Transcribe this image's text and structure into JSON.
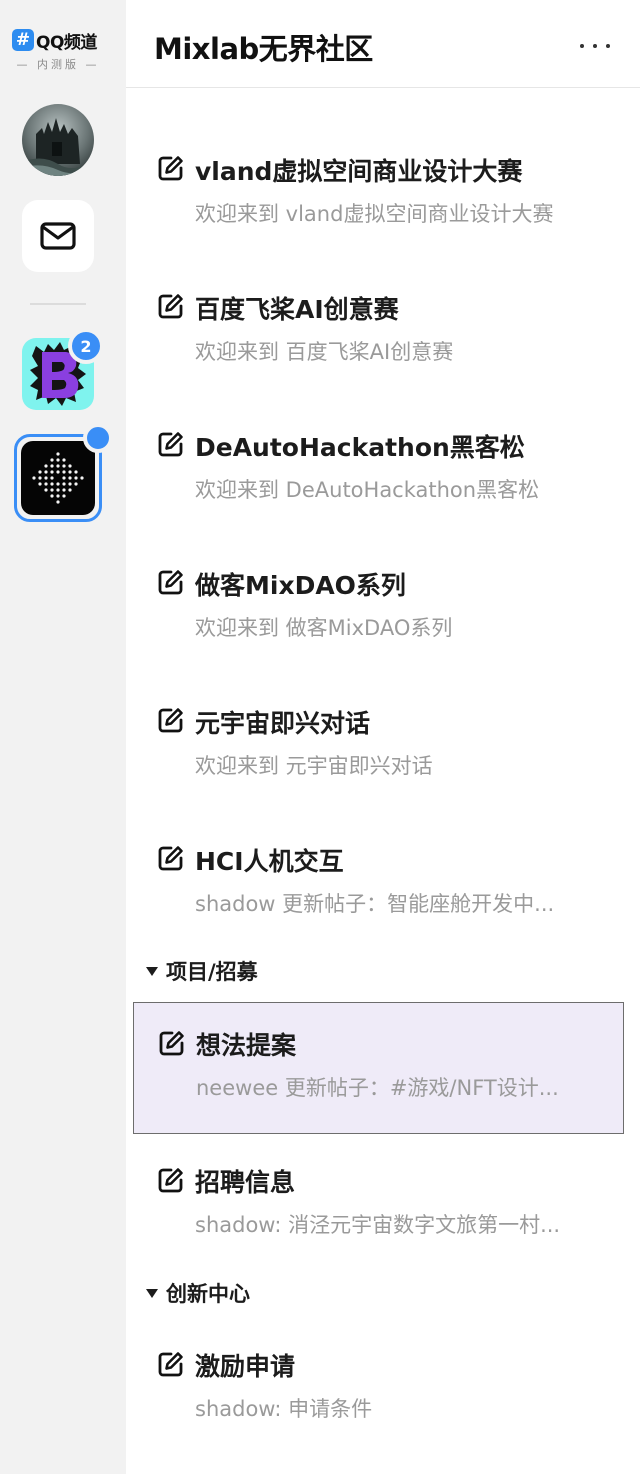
{
  "brand": {
    "hash": "#",
    "name": "QQ频道",
    "sub": "— 内测版 —"
  },
  "rail": {
    "mail_badge": "",
    "guild_b_badge": "2"
  },
  "header": {
    "title": "Mixlab无界社区"
  },
  "channels": [
    {
      "name": "vland虚拟空间商业设计大赛",
      "desc": "欢迎来到 vland虚拟空间商业设计大赛"
    },
    {
      "name": "百度飞桨AI创意赛",
      "desc": "欢迎来到 百度飞桨AI创意赛"
    },
    {
      "name": "DeAutoHackathon黑客松",
      "desc": "欢迎来到 DeAutoHackathon黑客松"
    },
    {
      "name": "做客MixDAO系列",
      "desc": "欢迎来到 做客MixDAO系列"
    },
    {
      "name": "元宇宙即兴对话",
      "desc": "欢迎来到 元宇宙即兴对话"
    },
    {
      "name": "HCI人机交互",
      "desc": "shadow 更新帖子：智能座舱开发中..."
    }
  ],
  "categories": [
    {
      "label": "项目/招募",
      "channels": [
        {
          "name": "想法提案",
          "desc": "neewee 更新帖子：#游戏/NFT设计..."
        },
        {
          "name": "招聘信息",
          "desc": "shadow: 消泾元宇宙数字文旅第一村..."
        }
      ]
    },
    {
      "label": "创新中心",
      "channels": [
        {
          "name": "激励申请",
          "desc": "shadow: 申请条件"
        }
      ]
    }
  ],
  "colors": {
    "accent": "#3a8ef6",
    "rail_bg": "#f2f2f2",
    "active_channel_bg": "#efebf8"
  }
}
